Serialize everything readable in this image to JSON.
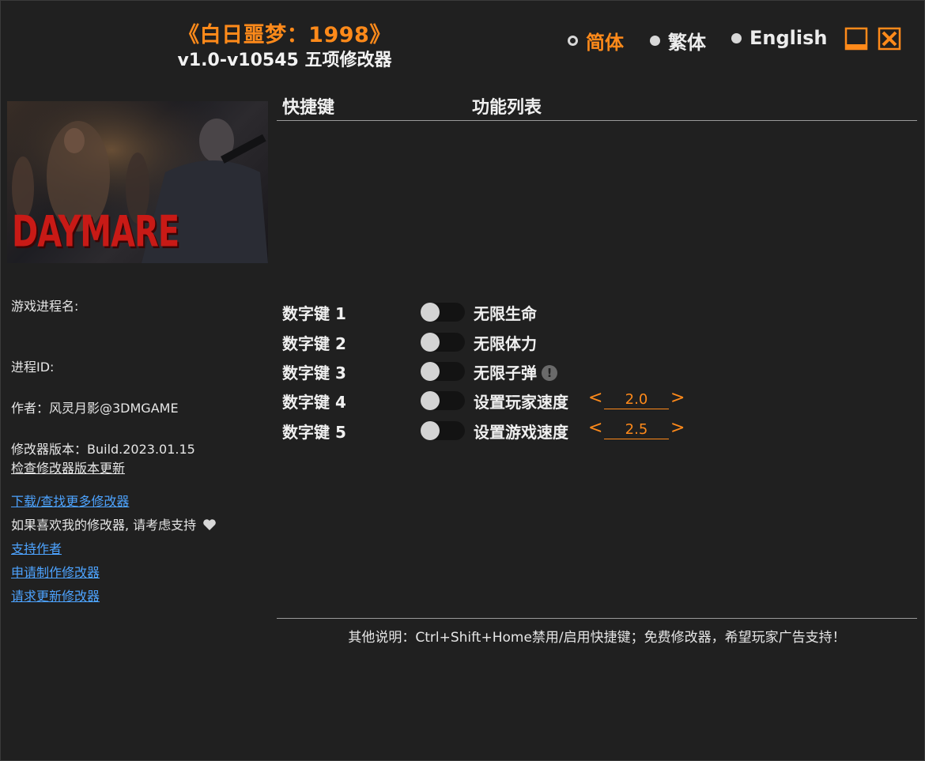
{
  "header": {
    "title": "《白日噩梦：1998》",
    "subtitle": "v1.0-v10545 五项修改器"
  },
  "languages": [
    {
      "label": "简体",
      "selected": true
    },
    {
      "label": "繁体",
      "selected": false
    },
    {
      "label": "English",
      "selected": false
    }
  ],
  "colors": {
    "accent": "#ff8a1a",
    "background": "#202020",
    "link": "#4da3ff"
  },
  "cover": {
    "logo_text": "DAYMARE"
  },
  "sidebar": {
    "process_name_label": "游戏进程名:",
    "process_id_label": "进程ID:",
    "author": "作者：风灵月影@3DMGAME",
    "version": "修改器版本：Build.2023.01.15",
    "check_update": "检查修改器版本更新",
    "download_more": "下载/查找更多修改器",
    "support_text": "如果喜欢我的修改器, 请考虑支持",
    "support_author": "支持作者",
    "request_make": "申请制作修改器",
    "request_update": "请求更新修改器"
  },
  "table": {
    "col_hotkey": "快捷键",
    "col_features": "功能列表",
    "rows": [
      {
        "hotkey": "数字键 1",
        "feature": "无限生命",
        "enabled": false
      },
      {
        "hotkey": "数字键 2",
        "feature": "无限体力",
        "enabled": false
      },
      {
        "hotkey": "数字键 3",
        "feature": "无限子弹",
        "enabled": false,
        "warning": "!"
      },
      {
        "hotkey": "数字键 4",
        "feature": "设置玩家速度",
        "enabled": false,
        "value": "2.0"
      },
      {
        "hotkey": "数字键 5",
        "feature": "设置游戏速度",
        "enabled": false,
        "value": "2.5"
      }
    ]
  },
  "stepper": {
    "decrease": "<",
    "increase": ">"
  },
  "footer": {
    "note": "其他说明：Ctrl+Shift+Home禁用/启用快捷键；免费修改器，希望玩家广告支持！"
  }
}
